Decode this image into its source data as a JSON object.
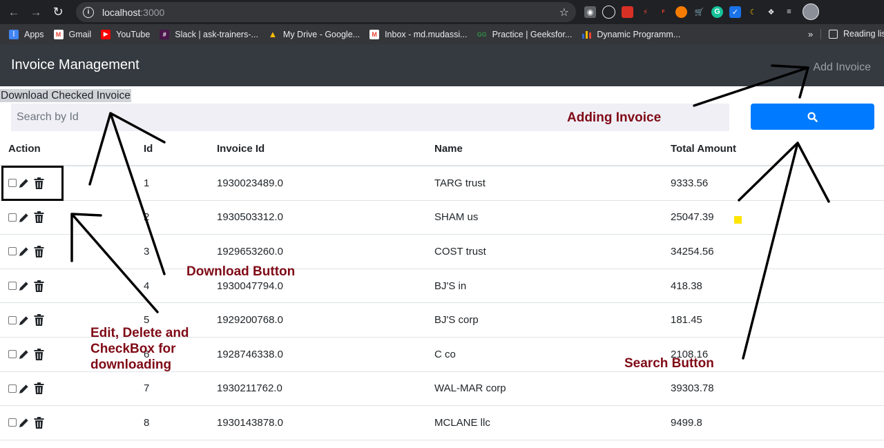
{
  "browser": {
    "url_host": "localhost",
    "url_port": ":3000",
    "bookmarks": [
      {
        "label": "Apps",
        "color": "#4285f4"
      },
      {
        "label": "Gmail",
        "color": "#ea4335"
      },
      {
        "label": "YouTube",
        "color": "#ff0000"
      },
      {
        "label": "Slack | ask-trainers-...",
        "color": "#4a154b"
      },
      {
        "label": "My Drive - Google...",
        "color": "#fbbc04"
      },
      {
        "label": "Inbox - md.mudassi...",
        "color": "#ea4335"
      },
      {
        "label": "Practice | Geeksfor...",
        "color": "#2f8d46"
      },
      {
        "label": "Dynamic Programm...",
        "color": "#3367d6"
      }
    ],
    "reading_list": "Reading lis"
  },
  "app": {
    "brand": "Invoice Management",
    "add_invoice": "Add Invoice",
    "download_checked": "Download Checked Invoice",
    "search_placeholder": "Search by Id"
  },
  "table": {
    "headers": {
      "action": "Action",
      "id": "Id",
      "invoice_id": "Invoice Id",
      "name": "Name",
      "total": "Total Amount"
    },
    "rows": [
      {
        "id": "1",
        "invoice_id": "1930023489.0",
        "name": "TARG trust",
        "total": "9333.56"
      },
      {
        "id": "2",
        "invoice_id": "1930503312.0",
        "name": "SHAM us",
        "total": "25047.39"
      },
      {
        "id": "3",
        "invoice_id": "1929653260.0",
        "name": "COST trust",
        "total": "34254.56"
      },
      {
        "id": "4",
        "invoice_id": "1930047794.0",
        "name": "BJ'S in",
        "total": "418.38"
      },
      {
        "id": "5",
        "invoice_id": "1929200768.0",
        "name": "BJ'S corp",
        "total": "181.45"
      },
      {
        "id": "6",
        "invoice_id": "1928746338.0",
        "name": "C co",
        "total": "2108.16"
      },
      {
        "id": "7",
        "invoice_id": "1930211762.0",
        "name": "WAL-MAR corp",
        "total": "39303.78"
      },
      {
        "id": "8",
        "invoice_id": "1930143878.0",
        "name": "MCLANE llc",
        "total": "9499.8"
      }
    ]
  },
  "annotations": {
    "adding_invoice": "Adding Invoice",
    "download_button": "Download Button",
    "search_button": "Search Button",
    "edit_delete": [
      "Edit, Delete and",
      "CheckBox for",
      "downloading"
    ]
  },
  "colors": {
    "navbar": "#343a40",
    "primary": "#007bff",
    "annotation_text": "#7f0a16",
    "search_bg": "#f0eff6"
  }
}
